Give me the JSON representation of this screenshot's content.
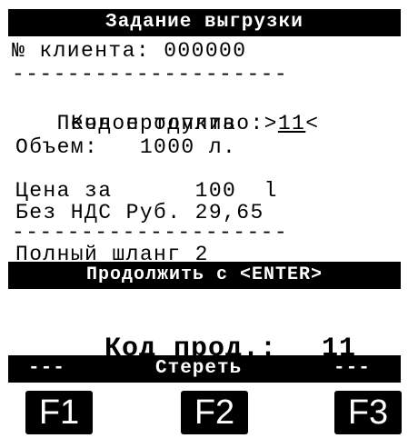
{
  "title": "Задание выгрузки",
  "client": "№ клиента: 000000",
  "divider1": "--------------------",
  "product_code_prefix": "Код продукта :>",
  "product_code_value": "11",
  "product_code_suffix": "<",
  "product_name": "   Печное топливо",
  "volume": "Объем:   1000 л.",
  "price_line1": "Цена за      100  l",
  "price_line2": "Без НДС Руб. 29,65",
  "divider2": "--------------------",
  "hose": "Полный шланг 2",
  "continue_prompt": "Продолжить с <ENTER>",
  "input_label": "Код прод.:",
  "input_value": "11",
  "softkeys": {
    "left": "---",
    "middle": "Стереть",
    "right": "---"
  },
  "function_keys": [
    "F1",
    "F2",
    "F3"
  ]
}
